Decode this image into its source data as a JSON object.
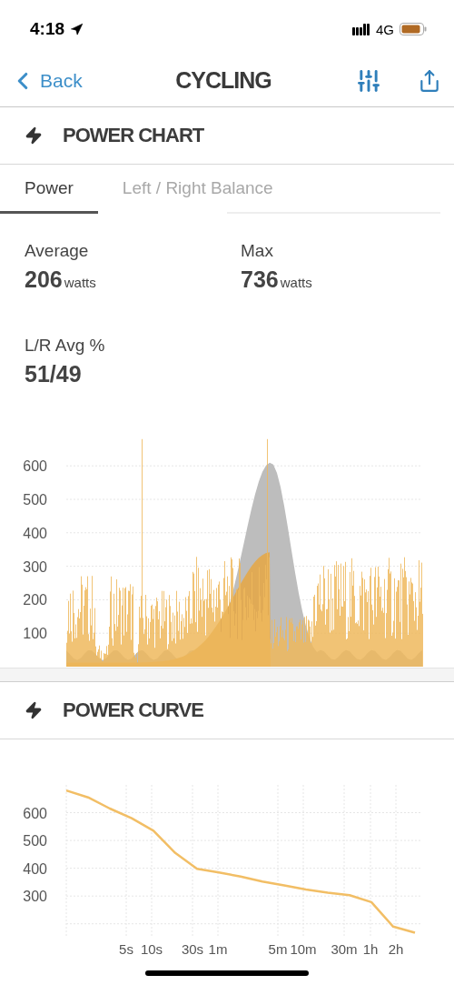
{
  "status_bar": {
    "time": "4:18",
    "network": "4G"
  },
  "nav": {
    "back": "Back",
    "title": "CYCLING"
  },
  "power_chart": {
    "title": "POWER CHART",
    "tabs": [
      {
        "label": "Power",
        "selected": true
      },
      {
        "label": "Left / Right Balance",
        "selected": false
      }
    ],
    "stats": [
      {
        "label": "Average",
        "value": "206",
        "unit": "watts"
      },
      {
        "label": "Max",
        "value": "736",
        "unit": "watts"
      },
      {
        "label": "L/R Avg %",
        "value": "51/49"
      }
    ],
    "y_labels": [
      "600",
      "500",
      "400",
      "300",
      "200",
      "100"
    ]
  },
  "power_curve": {
    "title": "POWER CURVE",
    "chart_data": {
      "type": "line",
      "series": [
        {
          "color": "#f2be65",
          "values": [
            680,
            655,
            615,
            580,
            535,
            455,
            398,
            385,
            370,
            352,
            338,
            324,
            312,
            303,
            278,
            190,
            168
          ]
        }
      ],
      "yticks": [
        600,
        500,
        400,
        300
      ],
      "ylim": [
        150,
        700
      ],
      "grid": true
    },
    "x_axis_labels": [
      "5s",
      "10s",
      "30s",
      "1m",
      "5m",
      "10m",
      "30m",
      "1h",
      "2h"
    ]
  }
}
